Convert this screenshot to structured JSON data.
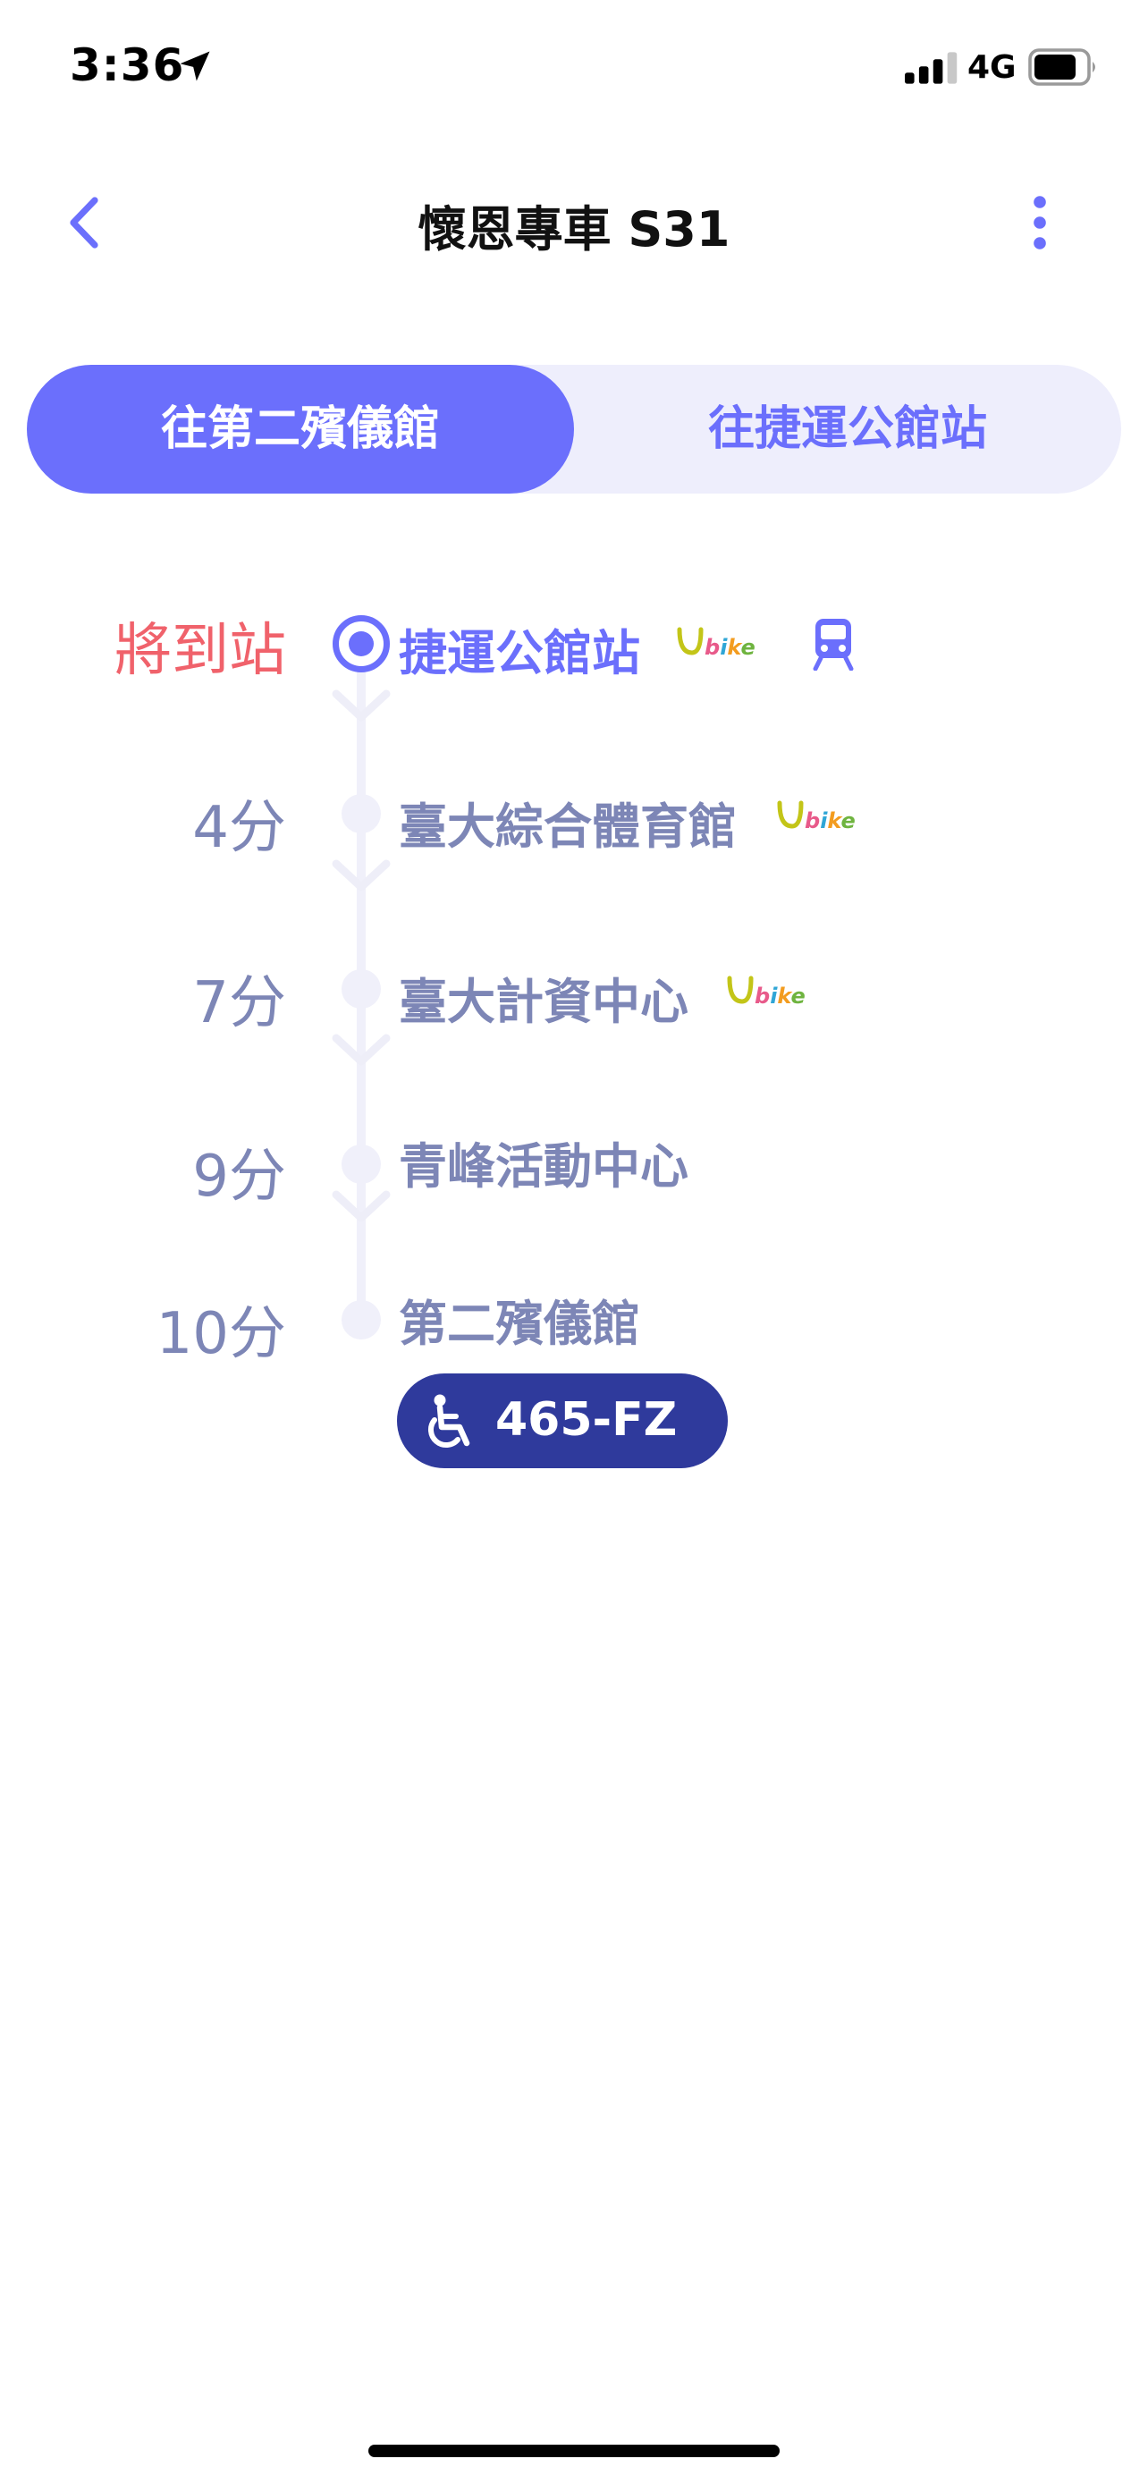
{
  "status_bar": {
    "time": "3:36",
    "network": "4G",
    "icons": [
      "location-arrow-icon",
      "cellular-signal-icon",
      "battery-icon"
    ]
  },
  "header": {
    "title": "懷恩專車 S31",
    "icons": [
      "chevron-left-icon",
      "more-vertical-icon"
    ]
  },
  "tabs": [
    {
      "label": "往第二殯儀館",
      "active": true
    },
    {
      "label": "往捷運公館站",
      "active": false
    }
  ],
  "stops": [
    {
      "eta": "將到站",
      "name": "捷運公館站",
      "current": true,
      "ubike": true,
      "metro": true
    },
    {
      "eta": "4分",
      "name": "臺大綜合體育館",
      "current": false,
      "ubike": true,
      "metro": false
    },
    {
      "eta": "7分",
      "name": "臺大計資中心",
      "current": false,
      "ubike": true,
      "metro": false
    },
    {
      "eta": "9分",
      "name": "青峰活動中心",
      "current": false,
      "ubike": false,
      "metro": false
    },
    {
      "eta": "10分",
      "name": "第二殯儀館",
      "current": false,
      "ubike": false,
      "metro": false
    }
  ],
  "bus": {
    "plate": "465-FZ",
    "accessible": true
  },
  "colors": {
    "accent": "#6b6ffc",
    "tab_track": "#eeeefc",
    "arriving": "#f0626b",
    "stop_text": "#7d86b6",
    "timeline": "#f0f0fa",
    "bus_badge": "#2f3a9c"
  }
}
